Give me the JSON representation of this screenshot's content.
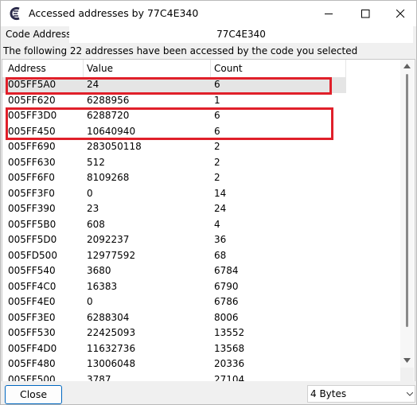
{
  "window": {
    "title": "Accessed addresses by 77C4E340"
  },
  "code_address": {
    "label": "Code Address",
    "value": "77C4E340"
  },
  "info_text": "The following 22 addresses have been accessed by the code you selected",
  "table": {
    "columns": [
      "Address",
      "Value",
      "Count"
    ],
    "rows": [
      {
        "address": "005FF5A0",
        "value": "24",
        "count": "6"
      },
      {
        "address": "005FF620",
        "value": "6288956",
        "count": "1"
      },
      {
        "address": "005FF3D0",
        "value": "6288720",
        "count": "6"
      },
      {
        "address": "005FF450",
        "value": "10640940",
        "count": "6"
      },
      {
        "address": "005FF690",
        "value": "283050118",
        "count": "2"
      },
      {
        "address": "005FF630",
        "value": "512",
        "count": "2"
      },
      {
        "address": "005FF6F0",
        "value": "8109268",
        "count": "2"
      },
      {
        "address": "005FF3F0",
        "value": "0",
        "count": "14"
      },
      {
        "address": "005FF390",
        "value": "23",
        "count": "24"
      },
      {
        "address": "005FF5B0",
        "value": "608",
        "count": "4"
      },
      {
        "address": "005FF5D0",
        "value": "2092237",
        "count": "36"
      },
      {
        "address": "005FD500",
        "value": "12977592",
        "count": "68"
      },
      {
        "address": "005FF540",
        "value": "3680",
        "count": "6784"
      },
      {
        "address": "005FF4C0",
        "value": "16383",
        "count": "6790"
      },
      {
        "address": "005FF4E0",
        "value": "0",
        "count": "6786"
      },
      {
        "address": "005FF3E0",
        "value": "6288304",
        "count": "8006"
      },
      {
        "address": "005FF530",
        "value": "22425093",
        "count": "13552"
      },
      {
        "address": "005FF4D0",
        "value": "11632736",
        "count": "13568"
      },
      {
        "address": "005FF480",
        "value": "13006048",
        "count": "20336"
      },
      {
        "address": "005FF500",
        "value": "3787",
        "count": "27104"
      }
    ]
  },
  "footer": {
    "close_label": "Close",
    "size_select_value": "4 Bytes"
  },
  "colors": {
    "highlight": "#e0202a",
    "selected_row": "#e5e5e5",
    "accent": "#0067c0"
  }
}
